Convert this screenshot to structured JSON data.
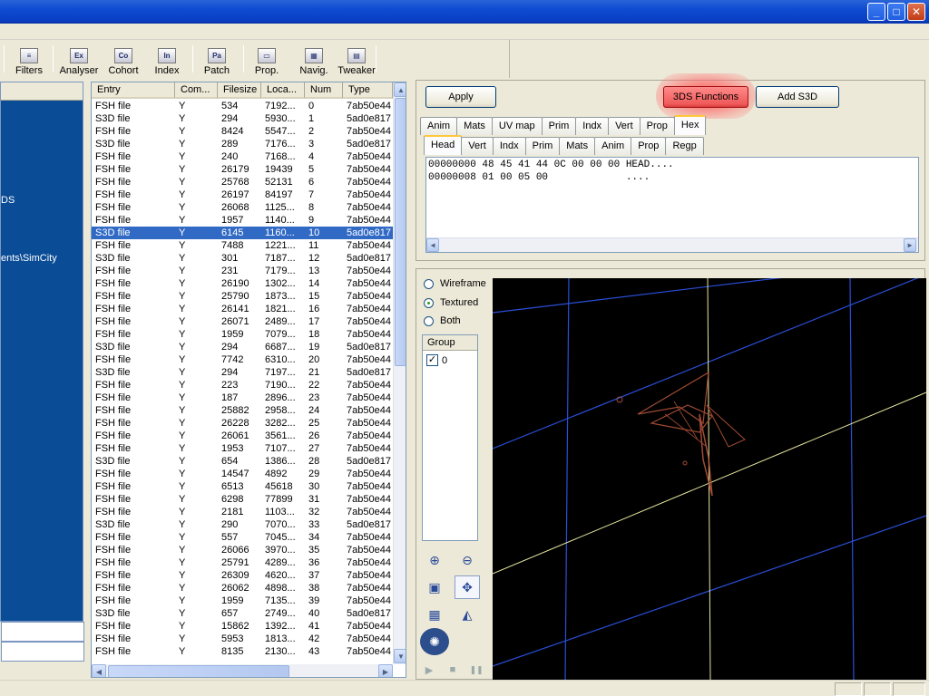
{
  "window": {
    "minimize_glyph": "_",
    "maximize_glyph": "□",
    "close_glyph": "✕"
  },
  "toolbar": {
    "items": [
      {
        "label": "Filters",
        "icon": "filters-icon",
        "glyph": "≡"
      },
      {
        "label": "Analyser",
        "icon": "analyser-icon",
        "glyph": "Ex"
      },
      {
        "label": "Cohort",
        "icon": "cohort-icon",
        "glyph": "Co"
      },
      {
        "label": "Index",
        "icon": "index-icon",
        "glyph": "In"
      },
      {
        "label": "Patch",
        "icon": "patch-icon",
        "glyph": "Pa"
      },
      {
        "label": "Prop.",
        "icon": "properties-icon",
        "glyph": "▭"
      },
      {
        "label": "Navig.",
        "icon": "navigator-icon",
        "glyph": "▦"
      },
      {
        "label": "Tweaker",
        "icon": "tweaker-icon",
        "glyph": "▤"
      }
    ]
  },
  "left_panel": {
    "fragment1": "DS",
    "fragment2": "ents\\SimCity"
  },
  "file_list": {
    "columns": [
      "Entry",
      "Com...",
      "Filesize",
      "Loca...",
      "Num",
      "Type"
    ],
    "selected_index": 10,
    "rows": [
      [
        "FSH file",
        "Y",
        "534",
        "7192...",
        "0",
        "7ab50e44"
      ],
      [
        "S3D file",
        "Y",
        "294",
        "5930...",
        "1",
        "5ad0e817"
      ],
      [
        "FSH file",
        "Y",
        "8424",
        "5547...",
        "2",
        "7ab50e44"
      ],
      [
        "S3D file",
        "Y",
        "289",
        "7176...",
        "3",
        "5ad0e817"
      ],
      [
        "FSH file",
        "Y",
        "240",
        "7168...",
        "4",
        "7ab50e44"
      ],
      [
        "FSH file",
        "Y",
        "26179",
        "19439",
        "5",
        "7ab50e44"
      ],
      [
        "FSH file",
        "Y",
        "25768",
        "52131",
        "6",
        "7ab50e44"
      ],
      [
        "FSH file",
        "Y",
        "26197",
        "84197",
        "7",
        "7ab50e44"
      ],
      [
        "FSH file",
        "Y",
        "26068",
        "1125...",
        "8",
        "7ab50e44"
      ],
      [
        "FSH file",
        "Y",
        "1957",
        "1140...",
        "9",
        "7ab50e44"
      ],
      [
        "S3D file",
        "Y",
        "6145",
        "1160...",
        "10",
        "5ad0e817"
      ],
      [
        "FSH file",
        "Y",
        "7488",
        "1221...",
        "11",
        "7ab50e44"
      ],
      [
        "S3D file",
        "Y",
        "301",
        "7187...",
        "12",
        "5ad0e817"
      ],
      [
        "FSH file",
        "Y",
        "231",
        "7179...",
        "13",
        "7ab50e44"
      ],
      [
        "FSH file",
        "Y",
        "26190",
        "1302...",
        "14",
        "7ab50e44"
      ],
      [
        "FSH file",
        "Y",
        "25790",
        "1873...",
        "15",
        "7ab50e44"
      ],
      [
        "FSH file",
        "Y",
        "26141",
        "1821...",
        "16",
        "7ab50e44"
      ],
      [
        "FSH file",
        "Y",
        "26071",
        "2489...",
        "17",
        "7ab50e44"
      ],
      [
        "FSH file",
        "Y",
        "1959",
        "7079...",
        "18",
        "7ab50e44"
      ],
      [
        "S3D file",
        "Y",
        "294",
        "6687...",
        "19",
        "5ad0e817"
      ],
      [
        "FSH file",
        "Y",
        "7742",
        "6310...",
        "20",
        "7ab50e44"
      ],
      [
        "S3D file",
        "Y",
        "294",
        "7197...",
        "21",
        "5ad0e817"
      ],
      [
        "FSH file",
        "Y",
        "223",
        "7190...",
        "22",
        "7ab50e44"
      ],
      [
        "FSH file",
        "Y",
        "187",
        "2896...",
        "23",
        "7ab50e44"
      ],
      [
        "FSH file",
        "Y",
        "25882",
        "2958...",
        "24",
        "7ab50e44"
      ],
      [
        "FSH file",
        "Y",
        "26228",
        "3282...",
        "25",
        "7ab50e44"
      ],
      [
        "FSH file",
        "Y",
        "26061",
        "3561...",
        "26",
        "7ab50e44"
      ],
      [
        "FSH file",
        "Y",
        "1953",
        "7107...",
        "27",
        "7ab50e44"
      ],
      [
        "S3D file",
        "Y",
        "654",
        "1386...",
        "28",
        "5ad0e817"
      ],
      [
        "FSH file",
        "Y",
        "14547",
        "4892",
        "29",
        "7ab50e44"
      ],
      [
        "FSH file",
        "Y",
        "6513",
        "45618",
        "30",
        "7ab50e44"
      ],
      [
        "FSH file",
        "Y",
        "6298",
        "77899",
        "31",
        "7ab50e44"
      ],
      [
        "FSH file",
        "Y",
        "2181",
        "1103...",
        "32",
        "7ab50e44"
      ],
      [
        "S3D file",
        "Y",
        "290",
        "7070...",
        "33",
        "5ad0e817"
      ],
      [
        "FSH file",
        "Y",
        "557",
        "7045...",
        "34",
        "7ab50e44"
      ],
      [
        "FSH file",
        "Y",
        "26066",
        "3970...",
        "35",
        "7ab50e44"
      ],
      [
        "FSH file",
        "Y",
        "25791",
        "4289...",
        "36",
        "7ab50e44"
      ],
      [
        "FSH file",
        "Y",
        "26309",
        "4620...",
        "37",
        "7ab50e44"
      ],
      [
        "FSH file",
        "Y",
        "26062",
        "4898...",
        "38",
        "7ab50e44"
      ],
      [
        "FSH file",
        "Y",
        "1959",
        "7135...",
        "39",
        "7ab50e44"
      ],
      [
        "S3D file",
        "Y",
        "657",
        "2749...",
        "40",
        "5ad0e817"
      ],
      [
        "FSH file",
        "Y",
        "15862",
        "1392...",
        "41",
        "7ab50e44"
      ],
      [
        "FSH file",
        "Y",
        "5953",
        "1813...",
        "42",
        "7ab50e44"
      ],
      [
        "FSH file",
        "Y",
        "8135",
        "2130...",
        "43",
        "7ab50e44"
      ]
    ],
    "scroll_up": "▲",
    "scroll_down": "▼",
    "scroll_left": "◀",
    "scroll_right": "▶"
  },
  "hex_panel": {
    "apply_label": "Apply",
    "functions_label": "3DS Functions",
    "add_s3d_label": "Add S3D",
    "tabs_top": [
      "Anim",
      "Mats",
      "UV map",
      "Prim",
      "Indx",
      "Vert",
      "Prop",
      "Hex"
    ],
    "tabs_top_active": 7,
    "tabs_sub": [
      "Head",
      "Vert",
      "Indx",
      "Prim",
      "Mats",
      "Anim",
      "Prop",
      "Regp"
    ],
    "tabs_sub_active": 0,
    "hex_lines": [
      "00000000 48 45 41 44 0C 00 00 00 HEAD....",
      "00000008 01 00 05 00             ...."
    ]
  },
  "viewer": {
    "render_modes": [
      "Wireframe",
      "Textured",
      "Both"
    ],
    "render_mode_selected": 1,
    "group_header": "Group",
    "group_items": [
      {
        "label": "0",
        "checked": true
      }
    ],
    "tools": [
      {
        "name": "zoom-in-icon",
        "glyph": "⊕"
      },
      {
        "name": "zoom-out-icon",
        "glyph": "⊖"
      },
      {
        "name": "fit-view-icon",
        "glyph": "▣"
      },
      {
        "name": "rotate-view-icon",
        "glyph": "✥"
      },
      {
        "name": "grid-toggle-icon",
        "glyph": "▦"
      },
      {
        "name": "perspective-icon",
        "glyph": "◭"
      },
      {
        "name": "lighting-icon",
        "glyph": "✺"
      }
    ],
    "playback": [
      {
        "name": "play-icon",
        "glyph": "▶"
      },
      {
        "name": "stop-icon",
        "glyph": "■"
      },
      {
        "name": "pause-icon",
        "glyph": "❚❚"
      }
    ],
    "colors": {
      "grid_blue": "#2a4fd8",
      "grid_yellow": "#e8e8a0",
      "model": "#b4543a"
    }
  }
}
